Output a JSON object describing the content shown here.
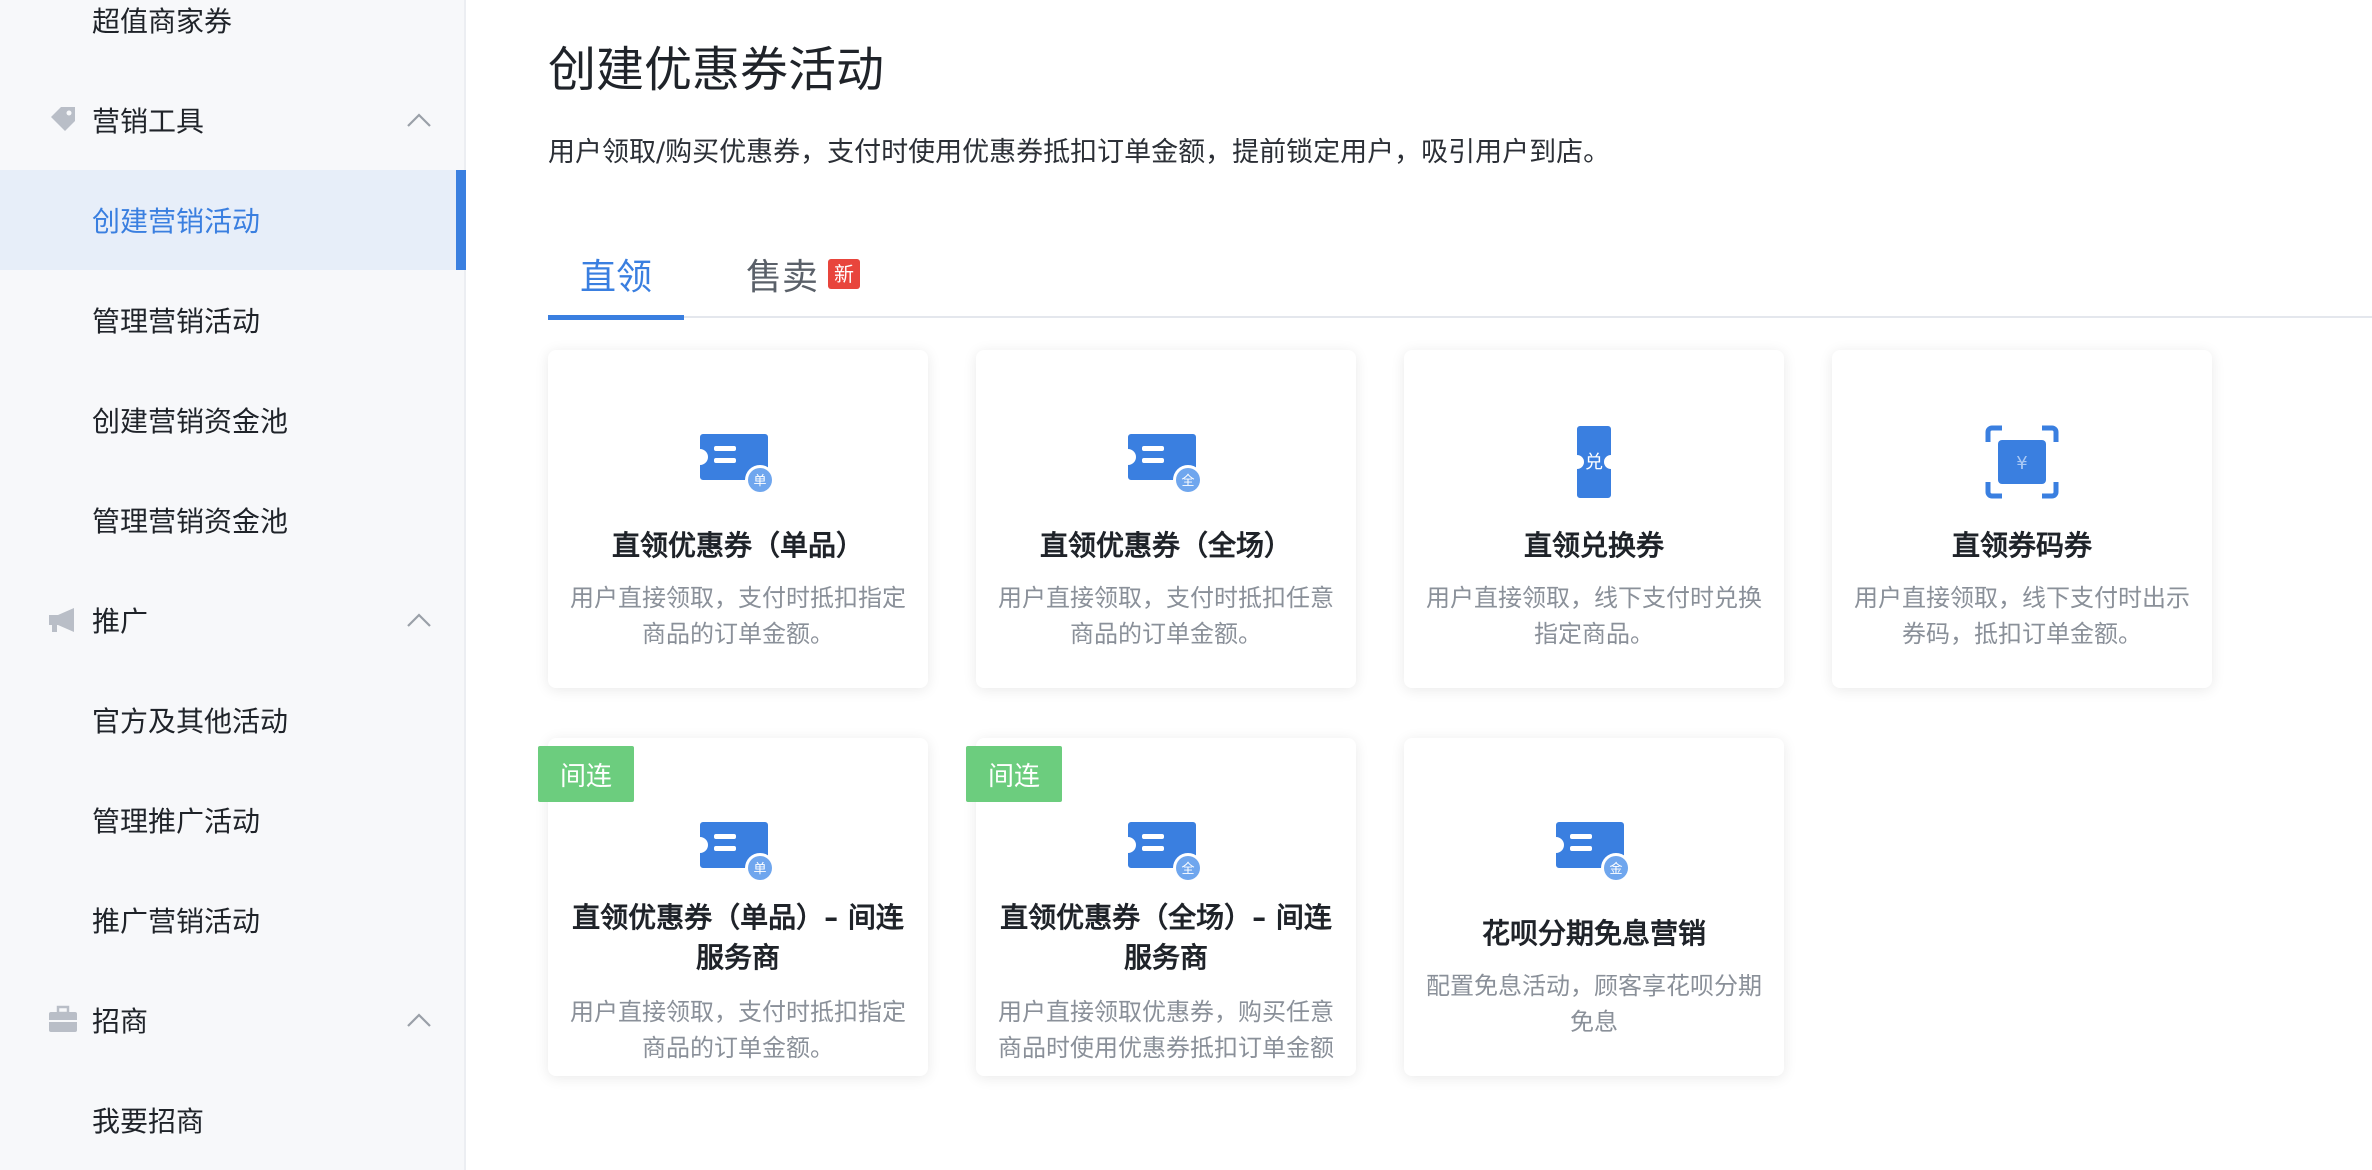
{
  "sidebar": {
    "top_item": "超值商家券",
    "groups": [
      {
        "label": "营销工具",
        "items": [
          "创建营销活动",
          "管理营销活动",
          "创建营销资金池",
          "管理营销资金池"
        ]
      },
      {
        "label": "推广",
        "items": [
          "官方及其他活动",
          "管理推广活动",
          "推广营销活动"
        ]
      },
      {
        "label": "招商",
        "items": [
          "我要招商"
        ]
      }
    ]
  },
  "main": {
    "title": "创建优惠券活动",
    "description": "用户领取/购买优惠券，支付时使用优惠券抵扣订单金额，提前锁定用户，吸引用户到店。",
    "tabs": [
      {
        "label": "直领"
      },
      {
        "label": "售卖",
        "badge": "新"
      }
    ],
    "cards": [
      {
        "title": "直领优惠券（单品）",
        "desc": "用户直接领取，支付时抵扣指定商品的订单金额。",
        "icon_badge": "单",
        "icon": "coupon-icon"
      },
      {
        "title": "直领优惠券（全场）",
        "desc": "用户直接领取，支付时抵扣任意商品的订单金额。",
        "icon_badge": "全",
        "icon": "coupon-icon"
      },
      {
        "title": "直领兑换券",
        "desc": "用户直接领取，线下支付时兑换指定商品。",
        "icon_badge": "兑",
        "icon": "exchange-ticket-icon"
      },
      {
        "title": "直领券码券",
        "desc": "用户直接领取，线下支付时出示券码，抵扣订单金额。",
        "icon_badge": "¥",
        "icon": "scan-code-icon"
      },
      {
        "tag": "间连",
        "title": "直领优惠券（单品）– 间连服务商",
        "desc": "用户直接领取，支付时抵扣指定商品的订单金额。",
        "icon_badge": "单",
        "icon": "coupon-icon"
      },
      {
        "tag": "间连",
        "title": "直领优惠券（全场）– 间连服务商",
        "desc": "用户直接领取优惠券，购买任意商品时使用优惠券抵扣订单金额",
        "icon_badge": "全",
        "icon": "coupon-icon"
      },
      {
        "title": "花呗分期免息营销",
        "desc": "配置免息活动，顾客享花呗分期免息",
        "icon_badge": "金",
        "icon": "coupon-icon"
      }
    ]
  },
  "colors": {
    "accent": "#3a7fe0",
    "tag_green": "#6ccd7e",
    "new_badge_red": "#e8453c"
  }
}
